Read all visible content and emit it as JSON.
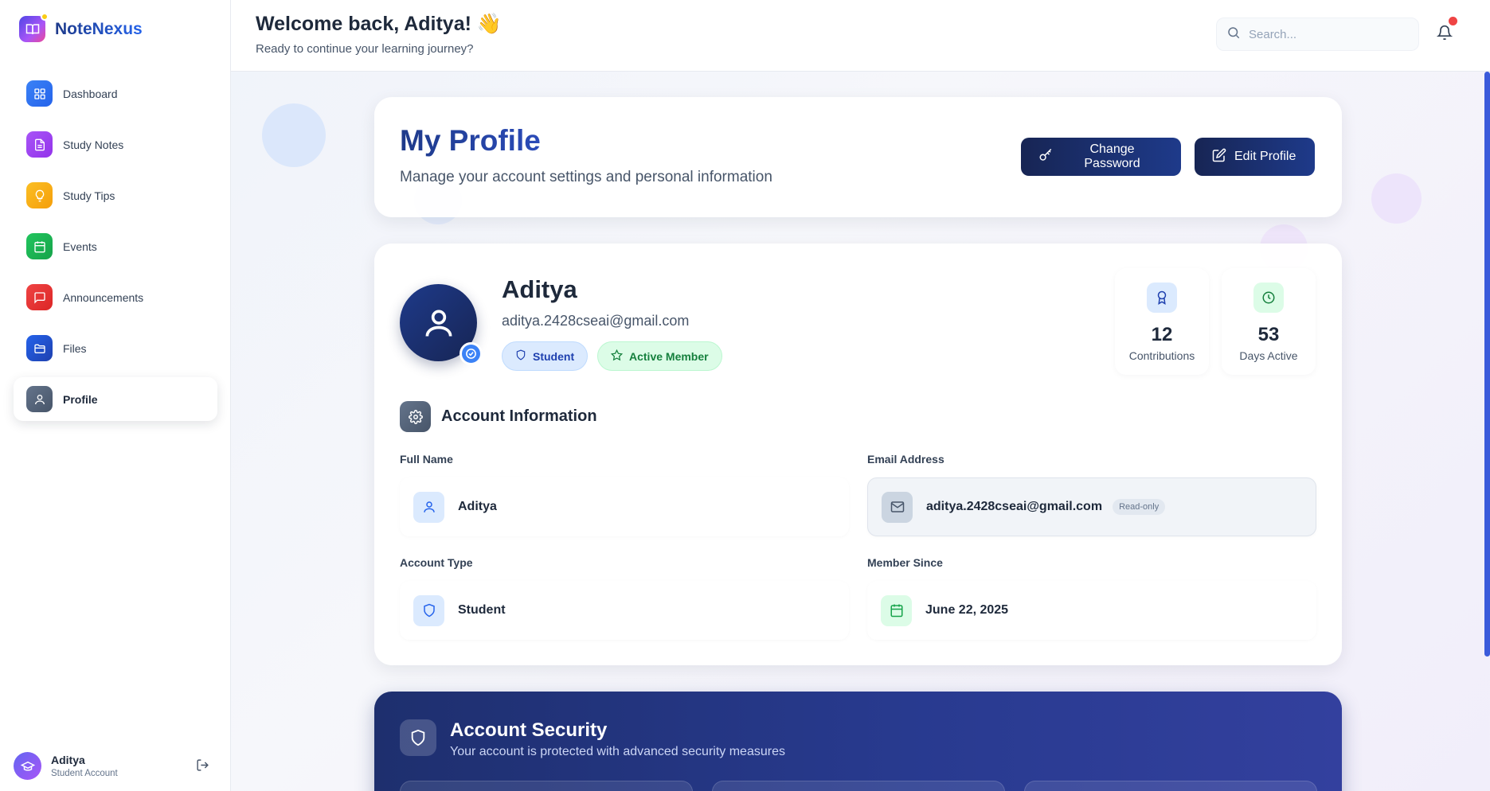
{
  "brand": {
    "name": "NoteNexus"
  },
  "sidebar": {
    "items": [
      {
        "label": "Dashboard",
        "icon": "grid-icon",
        "color": "#3b82f6"
      },
      {
        "label": "Study Notes",
        "icon": "document-icon",
        "color": "#a855f7"
      },
      {
        "label": "Study Tips",
        "icon": "lightbulb-icon",
        "color": "#f59e0b"
      },
      {
        "label": "Events",
        "icon": "calendar-icon",
        "color": "#22c55e"
      },
      {
        "label": "Announcements",
        "icon": "message-icon",
        "color": "#ef4444"
      },
      {
        "label": "Files",
        "icon": "folder-icon",
        "color": "#2563eb"
      },
      {
        "label": "Profile",
        "icon": "user-icon",
        "color": "#64748b",
        "active": true
      }
    ],
    "user": {
      "name": "Aditya",
      "role": "Student Account"
    }
  },
  "header": {
    "welcome": "Welcome back, Aditya! 👋",
    "subtitle": "Ready to continue your learning journey?",
    "search_placeholder": "Search..."
  },
  "profile_header": {
    "title": "My Profile",
    "subtitle": "Manage your account settings and personal information",
    "change_password_label": "Change Password",
    "edit_profile_label": "Edit Profile"
  },
  "profile": {
    "name": "Aditya",
    "email": "aditya.2428cseai@gmail.com",
    "badges": {
      "role": "Student",
      "status": "Active Member"
    },
    "stats": [
      {
        "value": "12",
        "label": "Contributions"
      },
      {
        "value": "53",
        "label": "Days Active"
      }
    ]
  },
  "account_info": {
    "title": "Account Information",
    "full_name": {
      "label": "Full Name",
      "value": "Aditya"
    },
    "email": {
      "label": "Email Address",
      "value": "aditya.2428cseai@gmail.com",
      "tag": "Read-only"
    },
    "account_type": {
      "label": "Account Type",
      "value": "Student"
    },
    "member_since": {
      "label": "Member Since",
      "value": "June 22, 2025"
    }
  },
  "security": {
    "title": "Account Security",
    "subtitle": "Your account is protected with advanced security measures"
  },
  "colors": {
    "accent": "#1e3a8a",
    "notification": "#ef4444"
  }
}
